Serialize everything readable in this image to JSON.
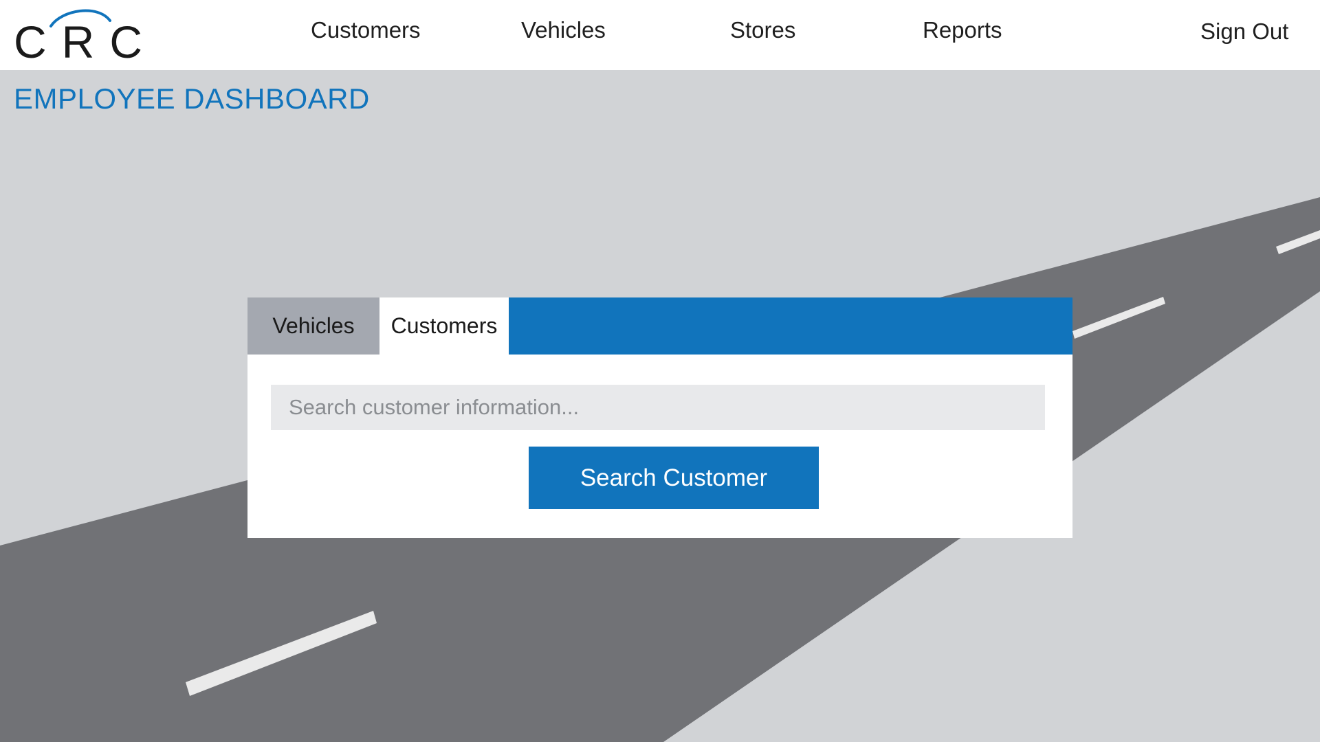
{
  "header": {
    "logo_text": "CRC",
    "nav": [
      {
        "label": "Customers"
      },
      {
        "label": "Vehicles"
      },
      {
        "label": "Stores"
      },
      {
        "label": "Reports"
      }
    ],
    "sign_out_label": "Sign Out"
  },
  "main": {
    "page_title": "EMPLOYEE DASHBOARD",
    "search_card": {
      "tabs": [
        {
          "label": "Vehicles",
          "active": false
        },
        {
          "label": "Customers",
          "active": true
        }
      ],
      "search_placeholder": "Search customer information...",
      "search_value": "",
      "search_button_label": "Search Customer"
    }
  },
  "colors": {
    "accent_blue": "#1174bc",
    "background_gray": "#d1d3d6",
    "road_gray": "#717276",
    "inactive_tab": "#a4a8b0",
    "input_background": "#e8e9eb",
    "lane_marking": "#eaeaea"
  }
}
